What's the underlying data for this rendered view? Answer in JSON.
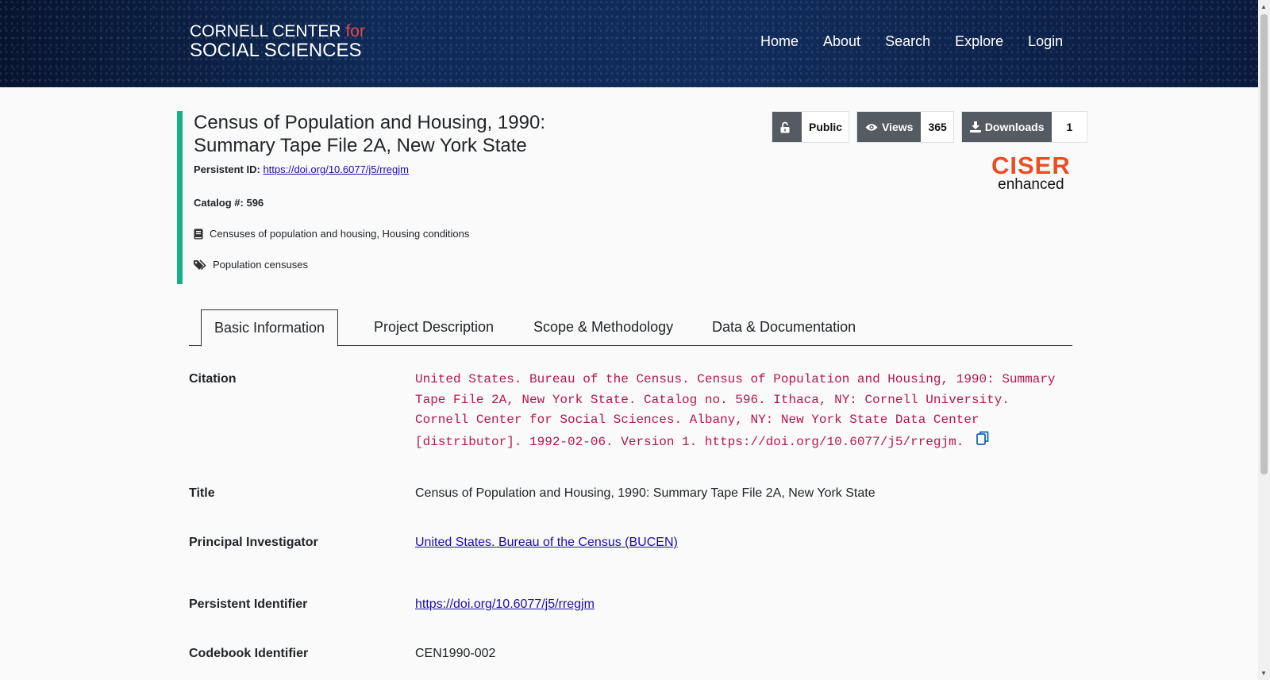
{
  "header": {
    "logo_line1_pre": "CORNELL CENTER ",
    "logo_line1_for": "for",
    "logo_line2": "SOCIAL SCIENCES",
    "nav": [
      "Home",
      "About",
      "Search",
      "Explore",
      "Login"
    ]
  },
  "record": {
    "title": "Census of Population and Housing, 1990: Summary Tape File 2A, New York State",
    "persistent_id_label": "Persistent ID:",
    "persistent_id_url": "https://doi.org/10.6077/j5/rregjm",
    "catalog_label": "Catalog #:",
    "catalog_number": "596",
    "subjects": "Censuses of population and housing, Housing conditions",
    "keywords": "Population censuses"
  },
  "badges": {
    "access": "Public",
    "views_label": "Views",
    "views_count": "365",
    "downloads_label": "Downloads",
    "downloads_count": "1"
  },
  "ciser": {
    "line1": "CISER",
    "line2": "enhanced"
  },
  "tabs": [
    "Basic Information",
    "Project Description",
    "Scope & Methodology",
    "Data & Documentation"
  ],
  "basic_info": {
    "citation_label": "Citation",
    "citation_text": "United States. Bureau of the Census. Census of Population and Housing, 1990: Summary Tape File 2A, New York State. Catalog no. 596. Ithaca, NY: Cornell University. Cornell Center for Social Sciences. Albany, NY: New York State Data Center [distributor]. 1992-02-06. Version 1. https://doi.org/10.6077/j5/rregjm.",
    "title_label": "Title",
    "title_value": "Census of Population and Housing, 1990: Summary Tape File 2A, New York State",
    "pi_label": "Principal Investigator",
    "pi_value": "United States. Bureau of the Census (BUCEN)",
    "pid_label": "Persistent Identifier",
    "pid_value": "https://doi.org/10.6077/j5/rregjm",
    "codebook_label": "Codebook Identifier",
    "codebook_value": "CEN1990-002"
  },
  "colors": {
    "accent_bar": "#14b089",
    "citation": "#b5174a",
    "badge_dark": "#555b62",
    "ciser_orange": "#ea4e24",
    "link": "#1a0dab"
  }
}
